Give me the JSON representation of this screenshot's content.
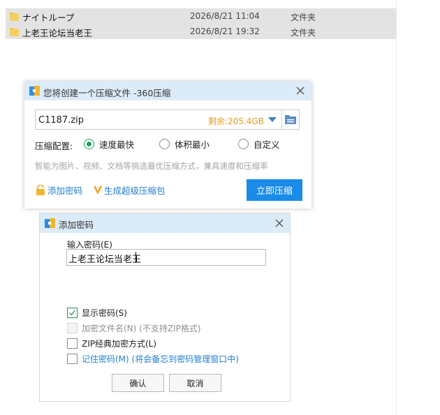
{
  "files": [
    {
      "name": "ナイトループ",
      "date": "2026/8/21 11:04",
      "type": "文件夹"
    },
    {
      "name": "上老王论坛当老王",
      "date": "2026/8/21 19:32",
      "type": "文件夹"
    }
  ],
  "compress_dialog": {
    "title": "您将创建一个压缩文件 -360压缩",
    "filename": "C1187.zip",
    "free_space": "剩余:205.4GB",
    "config_label": "压缩配置:",
    "options": [
      {
        "label": "速度最快",
        "selected": true
      },
      {
        "label": "体积最小",
        "selected": false
      },
      {
        "label": "自定义",
        "selected": false
      }
    ],
    "hint": "智能为图片、视频、文档等挑选最优压缩方式，兼具速度和压缩率",
    "add_password_label": "添加密码",
    "super_package_label": "生成超级压缩包",
    "compress_button": "立即压缩"
  },
  "password_dialog": {
    "title": "添加密码",
    "input_label": "输入密码(E)",
    "password_value": "上老王论坛当老王",
    "checkboxes": [
      {
        "label": "显示密码(S)",
        "checked": true,
        "enabled": true
      },
      {
        "label": "加密文件名(N) (不支持ZIP格式)",
        "checked": false,
        "enabled": false
      },
      {
        "label": "ZIP经典加密方式(L)",
        "checked": false,
        "enabled": true
      },
      {
        "label": "记住密码(M) (将会备忘到密码管理窗口中)",
        "checked": false,
        "enabled": true
      }
    ],
    "ok_button": "确认",
    "cancel_button": "取消"
  },
  "colors": {
    "accent_blue": "#1a8be8",
    "link_blue": "#1f7fd1",
    "radio_green": "#1aa35a",
    "free_space_orange": "#e39a1b",
    "titlebar_bg": "#dcebf8"
  }
}
